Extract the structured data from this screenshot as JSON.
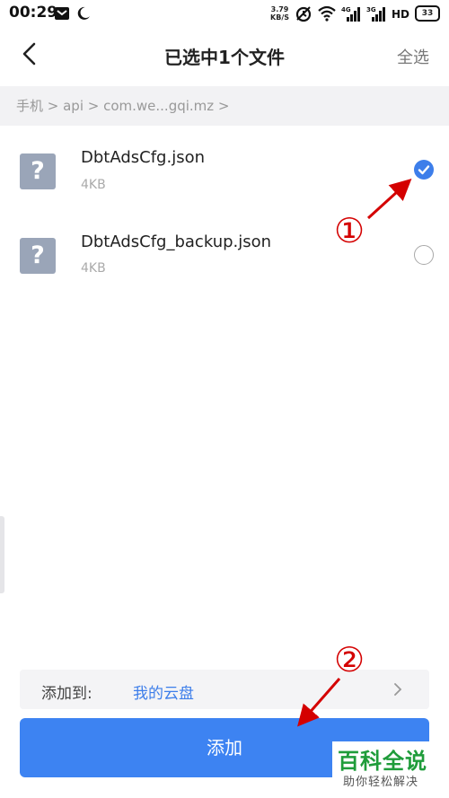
{
  "status_bar": {
    "time": "00:29",
    "speed_value": "3.79",
    "speed_unit": "KB/S",
    "battery": "33",
    "icons": [
      "message-icon",
      "moon-icon",
      "alarm-icon",
      "wifi-icon",
      "signal-4g-icon",
      "signal-3g-icon",
      "hd-icon",
      "battery-icon"
    ]
  },
  "header": {
    "title": "已选中1个文件",
    "select_all": "全选"
  },
  "breadcrumb": "手机 > api > com.we...gqi.mz >",
  "files": [
    {
      "icon": "?",
      "name": "DbtAdsCfg.json",
      "size": "4KB",
      "selected": true
    },
    {
      "icon": "?",
      "name": "DbtAdsCfg_backup.json",
      "size": "4KB",
      "selected": false
    }
  ],
  "destination": {
    "label": "添加到:",
    "value": "我的云盘"
  },
  "add_button": "添加",
  "annotations": {
    "first": "①",
    "second": "②",
    "color": "#d40000"
  },
  "watermark": {
    "title": "百科全说",
    "subtitle": "助你轻松解决"
  },
  "colors": {
    "accent": "#3d7eea",
    "button": "#3d83f2",
    "watermark_green": "#1f9c3a"
  }
}
